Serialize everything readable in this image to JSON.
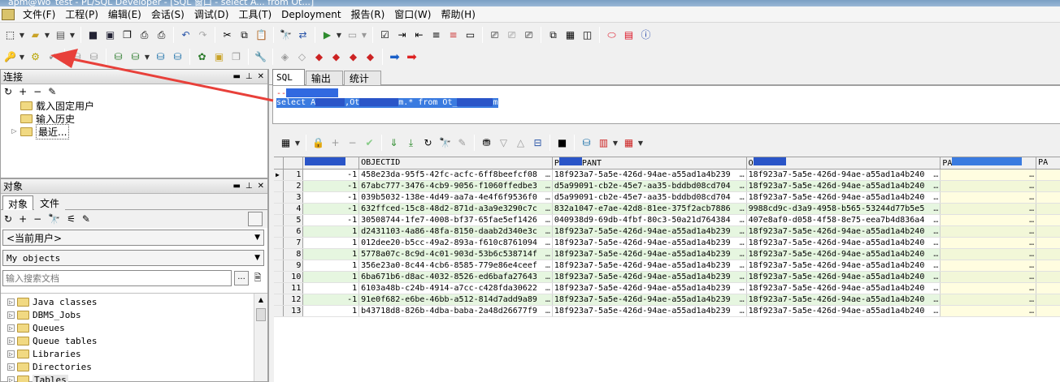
{
  "title_bar": {
    "text": "apm@Wo_test - PL/SQL Developer - [SQL 窗口 - select A... from Ot...]"
  },
  "menu": [
    "文件(F)",
    "工程(P)",
    "编辑(E)",
    "会话(S)",
    "调试(D)",
    "工具(T)",
    "Deployment",
    "报告(R)",
    "窗口(W)",
    "帮助(H)"
  ],
  "toolbar1_icons": [
    "new-icon",
    "open-icon",
    "print-icon",
    "save-icon",
    "save-all-icon",
    "copy-window-icon",
    "print-preview-icon",
    "printer-setup-icon",
    "undo-icon",
    "redo-icon",
    "cut-icon",
    "copy-icon",
    "paste-icon",
    "find-icon",
    "replace-icon",
    "execute-icon",
    "explain-icon",
    "describe-icon",
    "indent-icon",
    "unindent-icon",
    "uppercase-icon",
    "lowercase-icon",
    "comment-icon",
    "uncomment-icon",
    "tile-icon",
    "cascade-icon",
    "window-list-icon",
    "oracle-icon",
    "pdf-icon",
    "info-icon"
  ],
  "toolbar2_icons": [
    "key-icon",
    "gear-icon",
    "check-icon",
    "commit-icon",
    "rollback-icon",
    "db-connect-icon",
    "sql-icon",
    "db-add-icon",
    "db-remove-icon",
    "tools-icon",
    "report-icon",
    "copy-doc-icon",
    "wrench-icon",
    "tb-gray-1-icon",
    "eraser-icon",
    "red-bomb-icon",
    "red-bomb-2-icon",
    "red-bomb-3-icon",
    "arrow-right-blue-icon",
    "arrow-right-red-icon"
  ],
  "connection_panel": {
    "title": "连接",
    "items": [
      "载入固定用户",
      "输入历史",
      "最近..."
    ]
  },
  "object_panel": {
    "title": "对象",
    "tabs": [
      "对象",
      "文件"
    ],
    "user_select": "<当前用户>",
    "objects_select": "My objects",
    "search_placeholder": "输入搜索文档",
    "tree": [
      "Java classes",
      "DBMS_Jobs",
      "Queues",
      "Queue tables",
      "Libraries",
      "Directories",
      "Tables"
    ]
  },
  "sql_tabs": [
    "SQL",
    "输出",
    "统计"
  ],
  "sql_editor": {
    "line1": "--",
    "line2_parts": [
      "select A",
      ",Ot",
      "m.* from Ot_",
      "m"
    ]
  },
  "grid": {
    "columns": [
      "",
      "OBJECTID",
      "P",
      "PANT",
      "O",
      "PA",
      "PA"
    ],
    "rows": [
      {
        "n": "1",
        "val": "-1",
        "objectid": "458e23da-95f5-42fc-acfc-6ff8beefcf08",
        "pant": "18f923a7-5a5e-426d-94ae-a55ad1a4b239",
        "o": "18f923a7-5a5e-426d-94ae-a55ad1a4b240"
      },
      {
        "n": "2",
        "val": "-1",
        "objectid": "67abc777-3476-4cb9-9056-f1060ffedbe3",
        "pant": "d5a99091-cb2e-45e7-aa35-bddbd08cd704",
        "o": "18f923a7-5a5e-426d-94ae-a55ad1a4b240"
      },
      {
        "n": "3",
        "val": "-1",
        "objectid": "039b5032-138e-4d49-aa7a-4e4f6f9536f0",
        "pant": "d5a99091-cb2e-45e7-aa35-bddbd08cd704",
        "o": "18f923a7-5a5e-426d-94ae-a55ad1a4b240"
      },
      {
        "n": "4",
        "val": "-1",
        "objectid": "632ffced-15c8-48d2-871d-a3a9e3290c7c",
        "pant": "832a1047-e7ae-42d8-81ee-375f2acb7886",
        "o": "9988cd9c-d3a9-4958-b565-53244d77b5e5"
      },
      {
        "n": "5",
        "val": "-1",
        "objectid": "30508744-1fe7-4008-bf37-65fae5ef1426",
        "pant": "040938d9-69db-4fbf-80c3-50a21d764384",
        "o": "407e8af0-d058-4f58-8e75-eea7b4d836a4"
      },
      {
        "n": "6",
        "val": "1",
        "objectid": "d2431103-4a86-48fa-8150-daab2d340e3c",
        "pant": "18f923a7-5a5e-426d-94ae-a55ad1a4b239",
        "o": "18f923a7-5a5e-426d-94ae-a55ad1a4b240"
      },
      {
        "n": "7",
        "val": "1",
        "objectid": "012dee20-b5cc-49a2-893a-f610c8761094",
        "pant": "18f923a7-5a5e-426d-94ae-a55ad1a4b239",
        "o": "18f923a7-5a5e-426d-94ae-a55ad1a4b240"
      },
      {
        "n": "8",
        "val": "1",
        "objectid": "5778a07c-8c9d-4c01-903d-53b6c538714f",
        "pant": "18f923a7-5a5e-426d-94ae-a55ad1a4b239",
        "o": "18f923a7-5a5e-426d-94ae-a55ad1a4b240"
      },
      {
        "n": "9",
        "val": "1",
        "objectid": "356e23a0-8c44-4cb6-8585-779e86e4ceef",
        "pant": "18f923a7-5a5e-426d-94ae-a55ad1a4b239",
        "o": "18f923a7-5a5e-426d-94ae-a55ad1a4b240"
      },
      {
        "n": "10",
        "val": "1",
        "objectid": "6ba671b6-d8ac-4032-8526-ed6bafa27643",
        "pant": "18f923a7-5a5e-426d-94ae-a55ad1a4b239",
        "o": "18f923a7-5a5e-426d-94ae-a55ad1a4b240"
      },
      {
        "n": "11",
        "val": "1",
        "objectid": "6103a48b-c24b-4914-a7cc-c428fda30622",
        "pant": "18f923a7-5a5e-426d-94ae-a55ad1a4b239",
        "o": "18f923a7-5a5e-426d-94ae-a55ad1a4b240"
      },
      {
        "n": "12",
        "val": "-1",
        "objectid": "91e0f682-e6be-46bb-a512-814d7add9a89",
        "pant": "18f923a7-5a5e-426d-94ae-a55ad1a4b239",
        "o": "18f923a7-5a5e-426d-94ae-a55ad1a4b240"
      },
      {
        "n": "13",
        "val": "1",
        "objectid": "b43718d8-826b-4dba-baba-2a48d26677f9",
        "pant": "18f923a7-5a5e-426d-94ae-a55ad1a4b239",
        "o": "18f923a7-5a5e-426d-94ae-a55ad1a4b240"
      }
    ]
  },
  "colors": {
    "selection": "#3a7be0",
    "annotation_arrow": "#e8403a",
    "even_row": "#e6f6e0"
  }
}
